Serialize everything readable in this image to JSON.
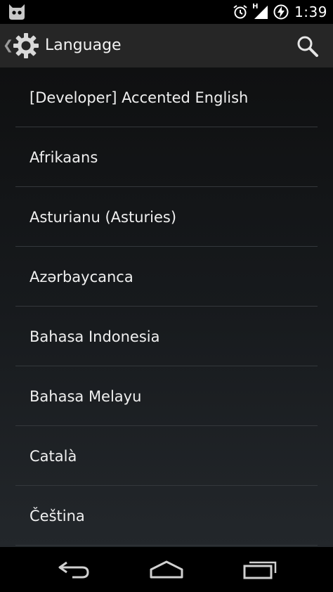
{
  "status_bar": {
    "time": "1:39",
    "network_label": "H",
    "icons": [
      "cyanogenmod-icon",
      "alarm-icon",
      "signal-icon",
      "battery-charging-icon"
    ]
  },
  "action_bar": {
    "title": "Language",
    "up_icon": "chevron-left-icon",
    "app_icon": "gear-icon",
    "action_icon": "search-icon"
  },
  "languages": [
    "[Developer] Accented English",
    "Afrikaans",
    "Asturianu (Asturies)",
    "Azərbaycanca",
    "Bahasa Indonesia",
    "Bahasa Melayu",
    "Català",
    "Čeština"
  ],
  "nav_bar": {
    "icons": [
      "back-icon",
      "home-icon",
      "recent-apps-icon"
    ]
  },
  "colors": {
    "action_bar_bg": "#262626",
    "list_text": "#f0f0f0",
    "divider": "#34383c"
  }
}
